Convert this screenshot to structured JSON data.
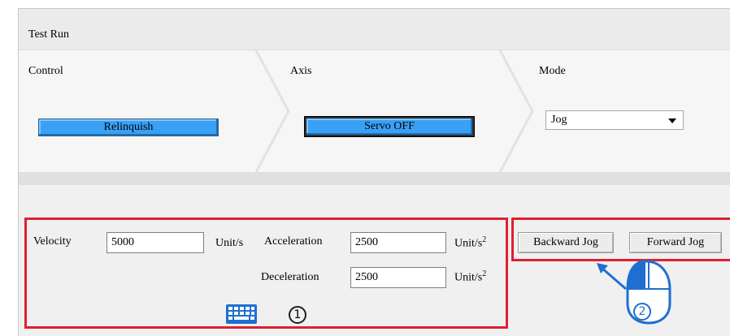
{
  "window": {
    "title": "Test Run"
  },
  "control": {
    "label": "Control",
    "button": "Relinquish"
  },
  "axis": {
    "label": "Axis",
    "button": "Servo OFF"
  },
  "mode": {
    "label": "Mode",
    "selected": "Jog"
  },
  "params": {
    "velocity": {
      "label": "Velocity",
      "value": "5000",
      "unit": "Unit/s"
    },
    "acceleration": {
      "label": "Acceleration",
      "value": "2500",
      "unit": "Unit/s",
      "unit_exp": "2"
    },
    "deceleration": {
      "label": "Deceleration",
      "value": "2500",
      "unit": "Unit/s",
      "unit_exp": "2"
    }
  },
  "jog": {
    "backward": "Backward Jog",
    "forward": "Forward Jog"
  },
  "annotations": {
    "step1": "1",
    "step2": "2",
    "highlight_color": "#e0202f",
    "icon_color": "#1f6fd1"
  },
  "icons": {
    "keyboard": "keyboard-icon",
    "mouse": "mouse-icon",
    "arrow": "pointer-arrow-icon"
  }
}
